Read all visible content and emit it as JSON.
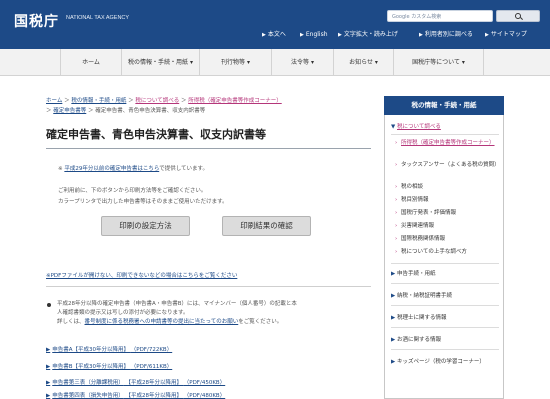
{
  "header": {
    "logo": "国税庁",
    "logo_en": "NATIONAL TAX AGENCY",
    "search_placeholder": "Google カスタム検索",
    "util_links": [
      "本文へ",
      "English",
      "文字拡大・読み上げ",
      "利用者別に調べる",
      "サイトマップ"
    ]
  },
  "nav": [
    "ホーム",
    "税の情報・手続・用紙",
    "刊行物等",
    "法令等",
    "お知らせ",
    "国税庁等について"
  ],
  "breadcrumb": {
    "items": [
      "ホーム",
      "税の情報・手続・用紙",
      "税について調べる",
      "所得税（確定申告書等作成コーナー）",
      "確定申告書等"
    ],
    "current": "確定申告書、青色申告決算書、収支内訳書等"
  },
  "title": "確定申告書、青色申告決算書、収支内訳書等",
  "note": {
    "link": "平成29年分以前の確定申告書はこちら",
    "text": "で提供しています。"
  },
  "paragraphs": [
    "ご利用前に、下のボタンから印刷方法等をご確認ください。",
    "カラープリンタで出力した申告書等はそのままご使用いただけます。"
  ],
  "buttons": {
    "print_settings": "印刷の設定方法",
    "print_check": "印刷結果の確認"
  },
  "pdf_note": "※PDFファイルが開けない、印刷できないなどの場合はこちらをご覧ください",
  "info": {
    "line1": "平成28年分以降の確定申告書（申告書A・申告書B）には、マイナンバー（個人番号）の記載と本",
    "line2": "人確認書類の提示又は写しの添付が必要になります。",
    "line3_prefix": "詳しくは、",
    "line3_link": "番号制度に係る税務署への申請書等の提出に当たってのお願い",
    "line3_suffix": "をご覧ください。"
  },
  "forms": [
    {
      "name": "申告書A",
      "year": "【平成30年分以降用】",
      "size": "（PDF/722KB）"
    },
    {
      "name": "申告書B",
      "year": "【平成30年分以降用】",
      "size": "（PDF/611KB）"
    },
    {
      "name": "申告書第三表（分離課税用）",
      "year": "【平成28年分以降用】",
      "size": "（PDF/450KB）"
    },
    {
      "name": "申告書第四表（損失申告用）",
      "year": "【平成28年分以降用】",
      "size": "（PDF/480KB）"
    }
  ],
  "sidebar": {
    "title": "税の情報・手続・用紙",
    "items": [
      {
        "label": "税について調べる",
        "type": "link"
      },
      {
        "label": "所得税（確定申告書等作成コーナー）",
        "type": "sub-link"
      },
      {
        "label": "タックスアンサー（よくある税の質問）",
        "type": "sub"
      },
      {
        "label": "税の相談",
        "type": "sub"
      },
      {
        "label": "税目別情報",
        "type": "sub"
      },
      {
        "label": "国税庁発表・評価情報",
        "type": "sub"
      },
      {
        "label": "災害関連情報",
        "type": "sub"
      },
      {
        "label": "国際税務関係情報",
        "type": "sub"
      },
      {
        "label": "税についての上手な調べ方",
        "type": "sub"
      },
      {
        "label": "申告手続・用紙",
        "type": "main"
      },
      {
        "label": "納税・納税証明書手続",
        "type": "main"
      },
      {
        "label": "税理士に関する情報",
        "type": "main"
      },
      {
        "label": "お酒に関する情報",
        "type": "main"
      },
      {
        "label": "キッズページ（税の学習コーナー）",
        "type": "main"
      }
    ]
  }
}
